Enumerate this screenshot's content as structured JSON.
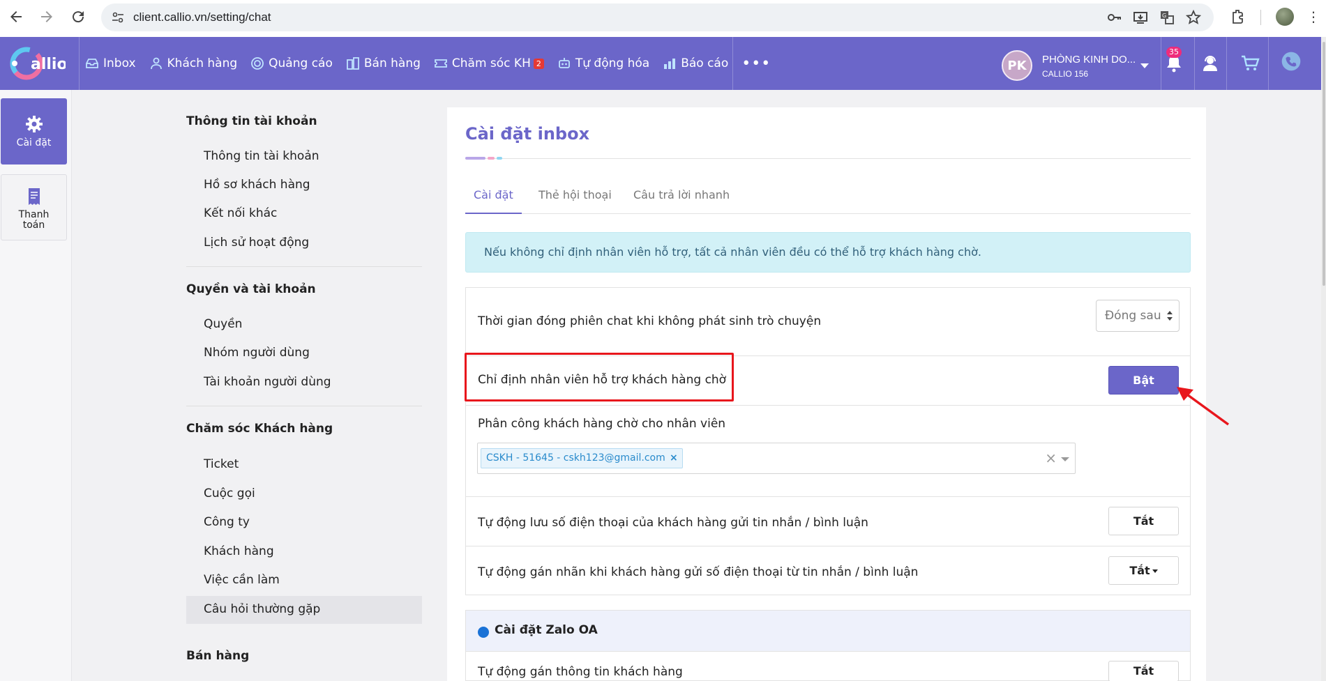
{
  "browser": {
    "url": "client.callio.vn/setting/chat"
  },
  "header": {
    "logo_text": "Callio",
    "menu": [
      {
        "label": "Inbox",
        "icon": "inbox-icon"
      },
      {
        "label": "Khách hàng",
        "icon": "user-icon"
      },
      {
        "label": "Quảng cáo",
        "icon": "target-icon"
      },
      {
        "label": "Bán hàng",
        "icon": "building-icon"
      },
      {
        "label": "Chăm sóc KH",
        "icon": "ticket-icon",
        "badge": "2"
      },
      {
        "label": "Tự động hóa",
        "icon": "robot-icon"
      },
      {
        "label": "Báo cáo",
        "icon": "bar-chart-icon"
      }
    ],
    "more": "•••",
    "account": {
      "initials": "PK",
      "name": "PHÒNG KINH DO...",
      "sub": "CALLIO 156"
    },
    "notifications_count": "35"
  },
  "rail": {
    "items": [
      {
        "label": "Cài đặt",
        "icon": "gear-icon"
      },
      {
        "label": "Thanh toán",
        "icon": "receipt-icon"
      }
    ]
  },
  "settings_nav": {
    "groups": [
      {
        "title": "Thông tin tài khoản",
        "links": [
          "Thông tin tài khoản",
          "Hồ sơ khách hàng",
          "Kết nối khác",
          "Lịch sử hoạt động"
        ]
      },
      {
        "title": "Quyền và tài khoản",
        "links": [
          "Quyền",
          "Nhóm người dùng",
          "Tài khoản người dùng"
        ]
      },
      {
        "title": "Chăm sóc Khách hàng",
        "links": [
          "Ticket",
          "Cuộc gọi",
          "Công ty",
          "Khách hàng",
          "Việc cần làm",
          "Câu hỏi thường gặp"
        ]
      },
      {
        "title": "Bán hàng",
        "links": []
      }
    ],
    "active_link": "Câu hỏi thường gặp"
  },
  "main": {
    "title": "Cài đặt inbox",
    "accent_colors": [
      "#b9a6e8",
      "#f3a6c8",
      "#8fd6f2"
    ],
    "tabs": [
      "Cài đặt",
      "Thẻ hội thoại",
      "Câu trả lời nhanh"
    ],
    "active_tab": "Cài đặt",
    "info": "Nếu không chỉ định nhân viên hỗ trợ, tất cả nhân viên đều có thể hỗ trợ khách hàng chờ.",
    "rows": {
      "close_session": {
        "label": "Thời gian đóng phiên chat khi không phát sinh trò chuyện",
        "select_value": "Đóng sau"
      },
      "assign_staff": {
        "label": "Chỉ định nhân viên hỗ trợ khách hàng chờ",
        "button": "Bật"
      },
      "assign_list": {
        "label": "Phân công khách hàng chờ cho nhân viên",
        "tag": "CSKH - 51645 - cskh123@gmail.com",
        "tag_remove": "×",
        "clear": "×"
      },
      "auto_save_phone": {
        "label": "Tự động lưu số điện thoại của khách hàng gửi tin nhắn / bình luận",
        "button": "Tắt"
      },
      "auto_label": {
        "label": "Tự động gán nhãn khi khách hàng gửi số điện thoại từ tin nhắn / bình luận",
        "button": "Tắt"
      }
    },
    "zalo": {
      "title": "Cài đặt Zalo OA",
      "row_label": "Tự động gán thông tin khách hàng",
      "button": "Tắt"
    }
  },
  "colors": {
    "brand": "#6b66c9",
    "info_bg": "#d2f1f7",
    "highlight": "#e8161c"
  }
}
